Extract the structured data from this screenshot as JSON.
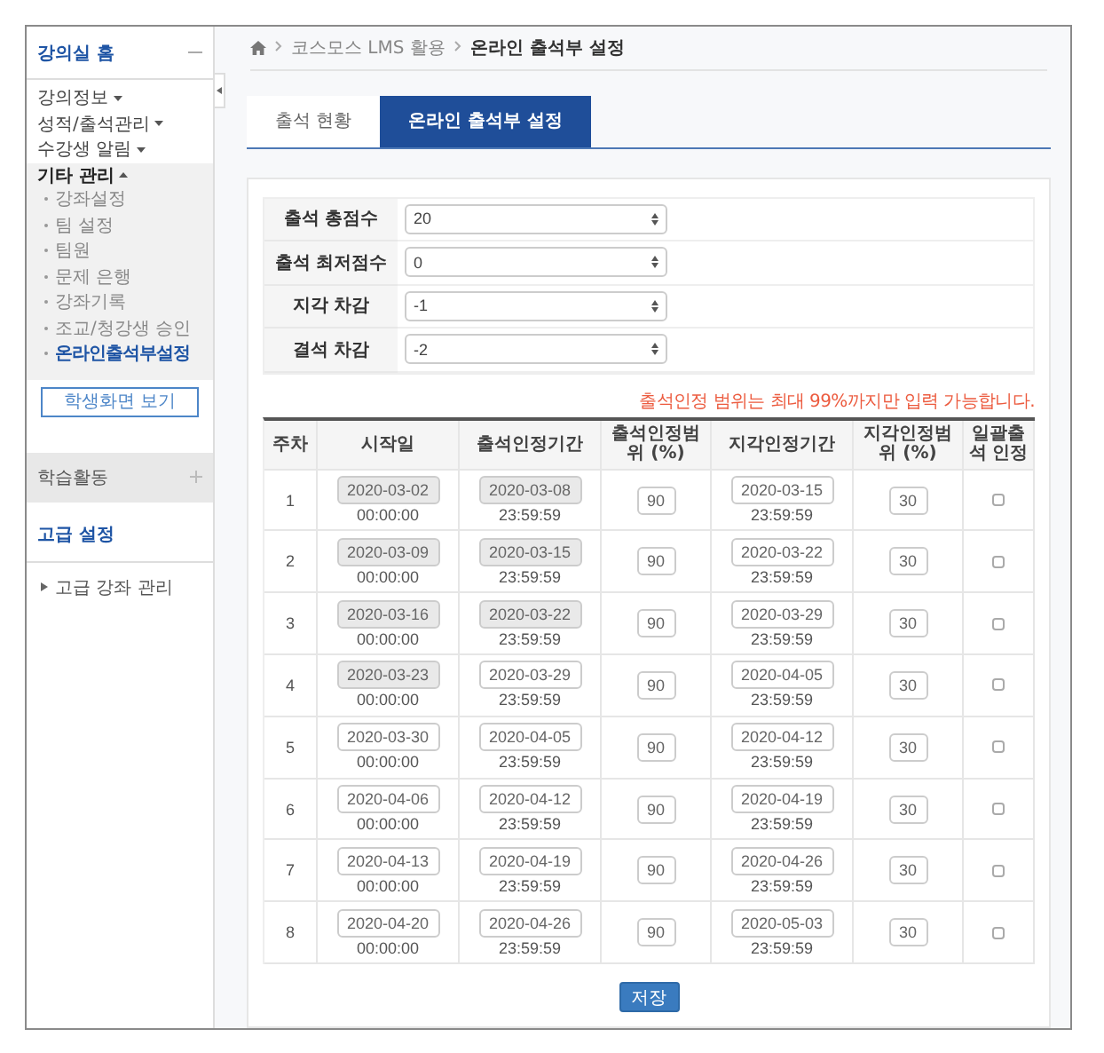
{
  "sidebar": {
    "title": "강의실 홈",
    "menu": [
      {
        "label": "강의정보",
        "expanded": false
      },
      {
        "label": "성적/출석관리",
        "expanded": false
      },
      {
        "label": "수강생 알림",
        "expanded": false
      },
      {
        "label": "기타 관리",
        "expanded": true,
        "children": [
          {
            "label": "강좌설정",
            "selected": false
          },
          {
            "label": "팀 설정",
            "selected": false
          },
          {
            "label": "팀원",
            "selected": false
          },
          {
            "label": "문제 은행",
            "selected": false
          },
          {
            "label": "강좌기록",
            "selected": false
          },
          {
            "label": "조교/청강생 승인",
            "selected": false
          },
          {
            "label": "온라인출석부설정",
            "selected": true
          }
        ]
      }
    ],
    "student_view_button": "학생화면 보기",
    "activity_section": "학습활동",
    "advanced_title": "고급 설정",
    "advanced_items": [
      {
        "label": "고급 강좌 관리",
        "expanded": false
      }
    ]
  },
  "breadcrumb": [
    "코스모스 LMS 활용",
    "온라인 출석부 설정"
  ],
  "tabs": [
    {
      "label": "출석 현황",
      "selected": false
    },
    {
      "label": "온라인 출석부 설정",
      "selected": true
    }
  ],
  "settings": [
    {
      "label": "출석 총점수",
      "value": "20"
    },
    {
      "label": "출석 최저점수",
      "value": "0"
    },
    {
      "label": "지각 차감",
      "value": "-1"
    },
    {
      "label": "결석 차감",
      "value": "-2"
    }
  ],
  "note": "출석인정 범위는 최대 99%까지만 입력 가능합니다.",
  "table": {
    "columns": [
      "주차",
      "시작일",
      "출석인정기간",
      "출석인정범위 (%)",
      "지각인정기간",
      "지각인정범위 (%)",
      "일괄출석 인정"
    ],
    "rows": [
      {
        "week": "1",
        "start_date": "2020-03-02",
        "start_time": "00:00:00",
        "start_disabled": true,
        "attend_date": "2020-03-08",
        "attend_time": "23:59:59",
        "attend_disabled": true,
        "attend_range": "90",
        "late_date": "2020-03-15",
        "late_time": "23:59:59",
        "late_range": "30",
        "checked": false
      },
      {
        "week": "2",
        "start_date": "2020-03-09",
        "start_time": "00:00:00",
        "start_disabled": true,
        "attend_date": "2020-03-15",
        "attend_time": "23:59:59",
        "attend_disabled": true,
        "attend_range": "90",
        "late_date": "2020-03-22",
        "late_time": "23:59:59",
        "late_range": "30",
        "checked": false
      },
      {
        "week": "3",
        "start_date": "2020-03-16",
        "start_time": "00:00:00",
        "start_disabled": true,
        "attend_date": "2020-03-22",
        "attend_time": "23:59:59",
        "attend_disabled": true,
        "attend_range": "90",
        "late_date": "2020-03-29",
        "late_time": "23:59:59",
        "late_range": "30",
        "checked": false
      },
      {
        "week": "4",
        "start_date": "2020-03-23",
        "start_time": "00:00:00",
        "start_disabled": true,
        "attend_date": "2020-03-29",
        "attend_time": "23:59:59",
        "attend_disabled": false,
        "attend_range": "90",
        "late_date": "2020-04-05",
        "late_time": "23:59:59",
        "late_range": "30",
        "checked": false
      },
      {
        "week": "5",
        "start_date": "2020-03-30",
        "start_time": "00:00:00",
        "start_disabled": false,
        "attend_date": "2020-04-05",
        "attend_time": "23:59:59",
        "attend_disabled": false,
        "attend_range": "90",
        "late_date": "2020-04-12",
        "late_time": "23:59:59",
        "late_range": "30",
        "checked": false
      },
      {
        "week": "6",
        "start_date": "2020-04-06",
        "start_time": "00:00:00",
        "start_disabled": false,
        "attend_date": "2020-04-12",
        "attend_time": "23:59:59",
        "attend_disabled": false,
        "attend_range": "90",
        "late_date": "2020-04-19",
        "late_time": "23:59:59",
        "late_range": "30",
        "checked": false
      },
      {
        "week": "7",
        "start_date": "2020-04-13",
        "start_time": "00:00:00",
        "start_disabled": false,
        "attend_date": "2020-04-19",
        "attend_time": "23:59:59",
        "attend_disabled": false,
        "attend_range": "90",
        "late_date": "2020-04-26",
        "late_time": "23:59:59",
        "late_range": "30",
        "checked": false
      },
      {
        "week": "8",
        "start_date": "2020-04-20",
        "start_time": "00:00:00",
        "start_disabled": false,
        "attend_date": "2020-04-26",
        "attend_time": "23:59:59",
        "attend_disabled": false,
        "attend_range": "90",
        "late_date": "2020-05-03",
        "late_time": "23:59:59",
        "late_range": "30",
        "checked": false
      }
    ]
  },
  "save_button": "저장"
}
